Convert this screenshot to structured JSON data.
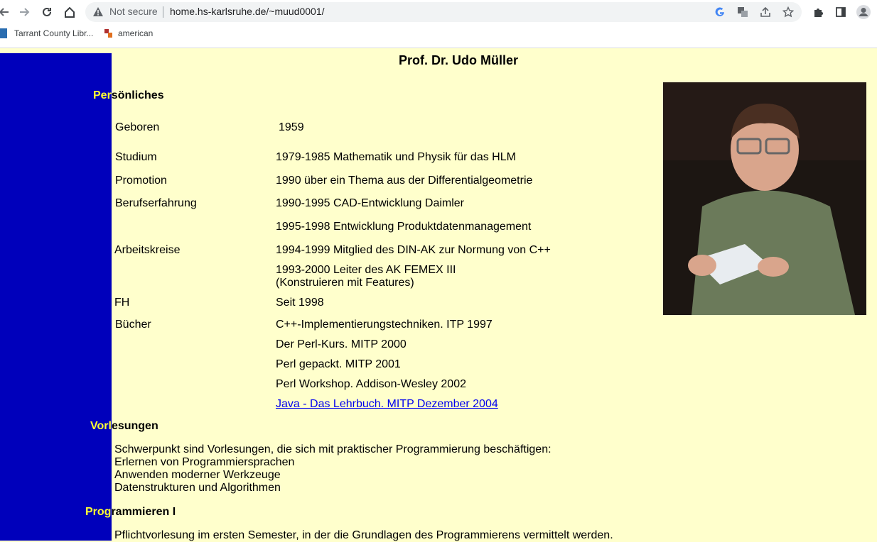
{
  "browser": {
    "security": "Not secure",
    "url": "home.hs-karlsruhe.de/~muud0001/",
    "bookmarks": [
      {
        "label": "Tarrant County Libr...",
        "icon": "library-favicon"
      },
      {
        "label": "american",
        "icon": "site-favicon"
      }
    ]
  },
  "page": {
    "title": "Prof. Dr. Udo Müller",
    "sections": {
      "personal": {
        "hl": "Per",
        "rest": "sönliches"
      },
      "lectures": {
        "hl": "Vorl",
        "rest": "esungen"
      },
      "prog1": {
        "hl": "Prog",
        "rest": "rammieren I"
      }
    },
    "rows": [
      {
        "label": "Geboren",
        "value": "1959"
      },
      {
        "label": "Studium",
        "value": "1979-1985 Mathematik und Physik für das HLM"
      },
      {
        "label": "Promotion",
        "value": "1990 über ein Thema aus der Differentialgeometrie"
      },
      {
        "label": "Berufserfahrung",
        "value": "1990-1995 CAD-Entwicklung Daimler"
      },
      {
        "label": "",
        "value": "1995-1998 Entwicklung Produktdatenmanagement"
      },
      {
        "label": "Arbeitskreise",
        "value": "1994-1999 Mitglied des DIN-AK zur Normung von C++"
      },
      {
        "label": "",
        "value": "1993-2000 Leiter des AK FEMEX III",
        "value2": "(Konstruieren mit Features)"
      },
      {
        "label": "FH",
        "value": "Seit 1998"
      },
      {
        "label": "Bücher",
        "value": "C++-Implementierungstechniken. ITP 1997"
      },
      {
        "label": "",
        "value": "Der Perl-Kurs. MITP 2000"
      },
      {
        "label": "",
        "value": "Perl gepackt. MITP 2001"
      },
      {
        "label": "",
        "value": "Perl Workshop. Addison-Wesley 2002"
      },
      {
        "label": "",
        "value": "Java - Das Lehrbuch. MITP Dezember 2004"
      }
    ],
    "lectures_text": [
      "Schwerpunkt sind Vorlesungen, die sich mit praktischer Programmierung beschäftigen:",
      "Erlernen von Programmiersprachen",
      "Anwenden moderner Werkzeuge",
      "Datenstrukturen und Algorithmen"
    ],
    "prog1_text": "Pflichtvorlesung im ersten Semester, in der die Grundlagen des Programmierens vermittelt werden."
  }
}
